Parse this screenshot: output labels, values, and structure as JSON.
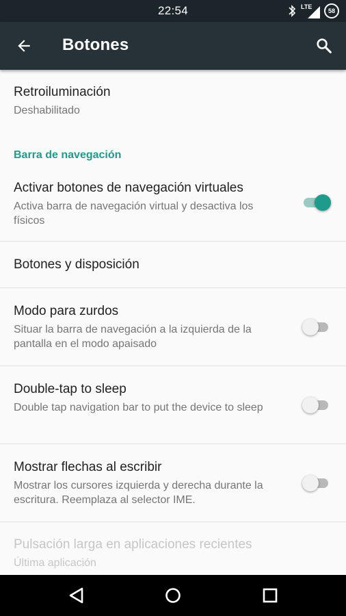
{
  "status_bar": {
    "time": "22:54",
    "network": "LTE",
    "battery": "58",
    "icons": [
      "bluetooth-icon",
      "lte-signal-icon",
      "battery-icon"
    ]
  },
  "app_bar": {
    "title": "Botones",
    "back_icon": "arrow-back-icon",
    "search_icon": "search-icon"
  },
  "settings": {
    "backlight": {
      "title": "Retroiluminación",
      "summary": "Deshabilitado"
    },
    "nav_section": {
      "label": "Barra de navegación"
    },
    "virtual_nav": {
      "title": "Activar botones de navegación virtuales",
      "summary": "Activa barra de navegación virtual y desactiva los físicos",
      "enabled": true
    },
    "layout": {
      "title": "Botones y disposición"
    },
    "left_hand": {
      "title": "Modo para zurdos",
      "summary": "Situar la barra de navegación a la izquierda de la pantalla en el modo apaisado",
      "enabled": false
    },
    "double_tap": {
      "title": "Double-tap to sleep",
      "summary": "Double tap navigation bar to put the device to sleep",
      "enabled": false
    },
    "arrows": {
      "title": "Mostrar flechas al escribir",
      "summary": "Mostrar los cursores izquierda y derecha durante la escritura. Reemplaza al selector IME.",
      "enabled": false
    },
    "long_press": {
      "title": "Pulsación larga en aplicaciones recientes",
      "summary": "Última aplicación",
      "disabled": true
    }
  },
  "nav_bar": {
    "icons": [
      "back-triangle-icon",
      "home-circle-icon",
      "recents-square-icon"
    ]
  },
  "colors": {
    "accent": "#1f9b8c",
    "app_bar": "#263238",
    "status_bar": "#1c2529"
  }
}
